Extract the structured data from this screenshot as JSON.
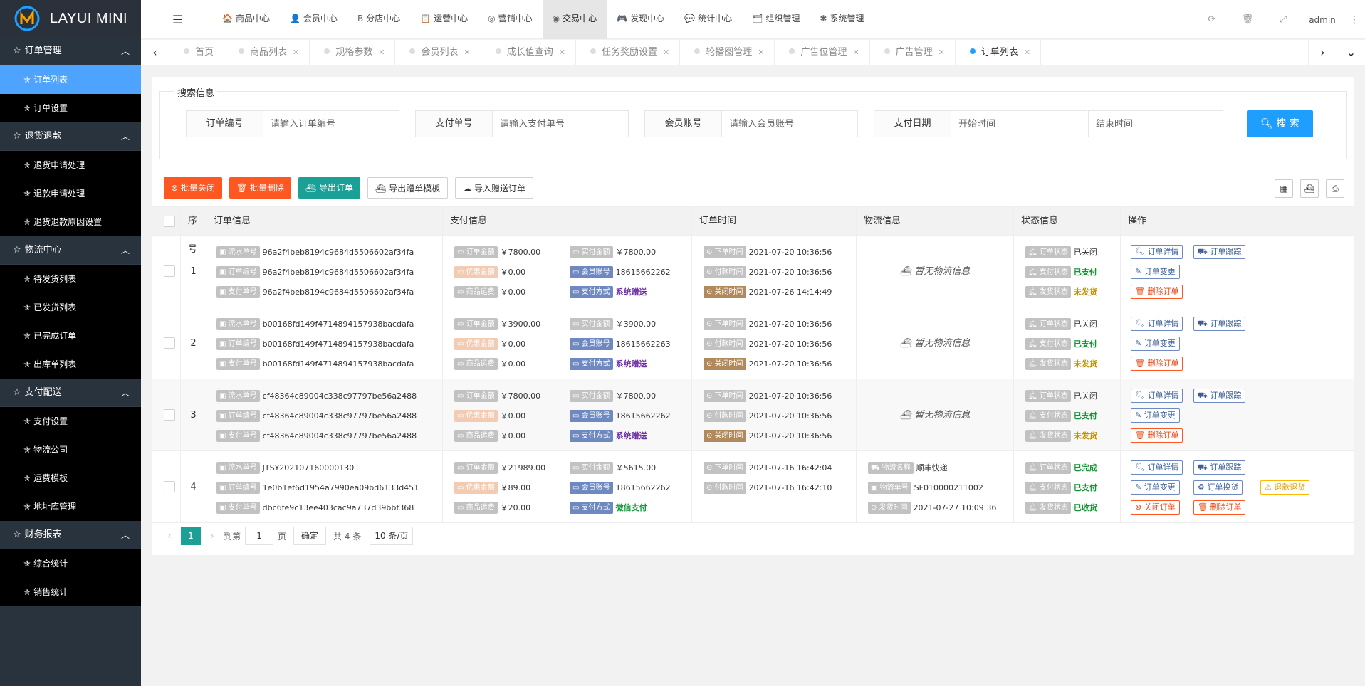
{
  "app": {
    "logo_text": "LAYUI MINI"
  },
  "sidebar": {
    "groups": [
      {
        "title": "订单管理",
        "items": [
          "订单列表",
          "订单设置"
        ]
      },
      {
        "title": "退货退款",
        "items": [
          "退货申请处理",
          "退款申请处理",
          "退货退款原因设置"
        ]
      },
      {
        "title": "物流中心",
        "items": [
          "待发货列表",
          "已发货列表",
          "已完成订单",
          "出库单列表"
        ]
      },
      {
        "title": "支付配送",
        "items": [
          "支付设置",
          "物流公司",
          "运费模板",
          "地址库管理"
        ]
      },
      {
        "title": "财务报表",
        "items": [
          "综合统计",
          "销售统计"
        ]
      }
    ],
    "active_item": "订单列表",
    "star": "☆",
    "item_star": "✯",
    "arrow": "︿"
  },
  "topnav": {
    "items": [
      {
        "label": "商品中心",
        "icon": "🏠"
      },
      {
        "label": "会员中心",
        "icon": "👤"
      },
      {
        "label": "分店中心",
        "icon": "B"
      },
      {
        "label": "运营中心",
        "icon": "📋"
      },
      {
        "label": "营销中心",
        "icon": "◎"
      },
      {
        "label": "交易中心",
        "icon": "◉"
      },
      {
        "label": "发现中心",
        "icon": "🎮"
      },
      {
        "label": "统计中心",
        "icon": "💬"
      },
      {
        "label": "组织管理",
        "icon": "🗂"
      },
      {
        "label": "系统管理",
        "icon": "✱"
      }
    ],
    "active": "交易中心",
    "user": "admin"
  },
  "tabs": {
    "items": [
      "首页",
      "商品列表",
      "规格参数",
      "会员列表",
      "成长值查询",
      "任务奖励设置",
      "轮播图管理",
      "广告位管理",
      "广告管理",
      "订单列表"
    ],
    "active": "订单列表"
  },
  "search": {
    "legend": "搜索信息",
    "fields": [
      {
        "label": "订单编号",
        "placeholder": "请输入订单编号"
      },
      {
        "label": "支付单号",
        "placeholder": "请输入支付单号"
      },
      {
        "label": "会员账号",
        "placeholder": "请输入会员账号"
      },
      {
        "label": "支付日期",
        "placeholder": "开始时间"
      }
    ],
    "end_placeholder": "结束时间",
    "button": "搜 索"
  },
  "toolbar": {
    "batch_close": "批量关闭",
    "batch_delete": "批量删除",
    "export_orders": "导出订单",
    "export_gift_template": "导出赠单模板",
    "import_gift_orders": "导入赠送订单"
  },
  "table": {
    "headers": [
      "序号",
      "订单信息",
      "支付信息",
      "订单时间",
      "物流信息",
      "状态信息",
      "操作"
    ],
    "labels": {
      "serial_no": "流水单号",
      "order_no": "订单编号",
      "pay_no": "支付单号",
      "order_amount": "订单金额",
      "paid_amount": "实付金额",
      "discount": "优惠金额",
      "member": "会员账号",
      "shipping_fee": "商品运费",
      "pay_method": "支付方式",
      "order_time": "下单时间",
      "pay_time": "付款时间",
      "close_time": "关闭时间",
      "ship_time": "发货时间",
      "logistics_name": "物流名称",
      "logistics_no": "物流单号",
      "order_status": "订单状态",
      "pay_status": "支付状态",
      "ship_status": "发货状态"
    },
    "no_logistics": "暂无物流信息",
    "ops": {
      "detail": "订单详情",
      "track": "订单跟踪",
      "change": "订单变更",
      "delete": "删除订单",
      "close": "关闭订单",
      "exchange": "订单换货",
      "refund": "退款退货"
    },
    "rows": [
      {
        "seq": "1",
        "serial_no": "96a2f4beb8194c9684d5506602af34fa",
        "order_no": "96a2f4beb8194c9684d5506602af34fa",
        "pay_no": "96a2f4beb8194c9684d5506602af34fa",
        "order_amount": "￥7800.00",
        "paid_amount": "￥7800.00",
        "discount": "￥0.00",
        "member": "18615662262",
        "shipping_fee": "￥0.00",
        "pay_method": "系统赠送",
        "order_time": "2021-07-20 10:36:56",
        "pay_time": "2021-07-20 10:36:56",
        "third_time": "2021-07-26 14:14:49",
        "order_status": "已关闭",
        "pay_status": "已支付",
        "ship_status": "未发货"
      },
      {
        "seq": "2",
        "serial_no": "b00168fd149f4714894157938bacdafa",
        "order_no": "b00168fd149f4714894157938bacdafa",
        "pay_no": "b00168fd149f4714894157938bacdafa",
        "order_amount": "￥3900.00",
        "paid_amount": "￥3900.00",
        "discount": "￥0.00",
        "member": "18615662263",
        "shipping_fee": "￥0.00",
        "pay_method": "系统赠送",
        "order_time": "2021-07-20 10:36:56",
        "pay_time": "2021-07-20 10:36:56",
        "third_time": "2021-07-20 10:36:56",
        "order_status": "已关闭",
        "pay_status": "已支付",
        "ship_status": "未发货"
      },
      {
        "seq": "3",
        "serial_no": "cf48364c89004c338c97797be56a2488",
        "order_no": "cf48364c89004c338c97797be56a2488",
        "pay_no": "cf48364c89004c338c97797be56a2488",
        "order_amount": "￥7800.00",
        "paid_amount": "￥7800.00",
        "discount": "￥0.00",
        "member": "18615662262",
        "shipping_fee": "￥0.00",
        "pay_method": "系统赠送",
        "order_time": "2021-07-20 10:36:56",
        "pay_time": "2021-07-20 10:36:56",
        "third_time": "2021-07-20 10:36:56",
        "order_status": "已关闭",
        "pay_status": "已支付",
        "ship_status": "未发货"
      },
      {
        "seq": "4",
        "serial_no": "JTSY202107160000130",
        "order_no": "1e0b1ef6d1954a7990ea09bd6133d451",
        "pay_no": "dbc6fe9c13ee403cac9a737d39bbf368",
        "order_amount": "￥21989.00",
        "paid_amount": "￥5615.00",
        "discount": "￥89.00",
        "member": "18615662262",
        "shipping_fee": "￥20.00",
        "pay_method": "微信支付",
        "order_time": "2021-07-16 16:42:04",
        "pay_time": "2021-07-16 16:42:10",
        "logistics_name": "顺丰快递",
        "logistics_no": "SF010000211002",
        "ship_time": "2021-07-27 10:09:36",
        "order_status": "已完成",
        "pay_status": "已支付",
        "ship_status": "已收货"
      }
    ]
  },
  "pager": {
    "current": "1",
    "goto": "到第",
    "page_input": "1",
    "page_unit": "页",
    "confirm": "确定",
    "total": "共 4 条",
    "per_page": "10 条/页"
  },
  "colors": {
    "sidebar_bg": "#28333e",
    "active_blue": "#4ea3ff",
    "accent_green": "#1aa094",
    "danger": "#ff5722",
    "primary": "#1e9fff"
  }
}
